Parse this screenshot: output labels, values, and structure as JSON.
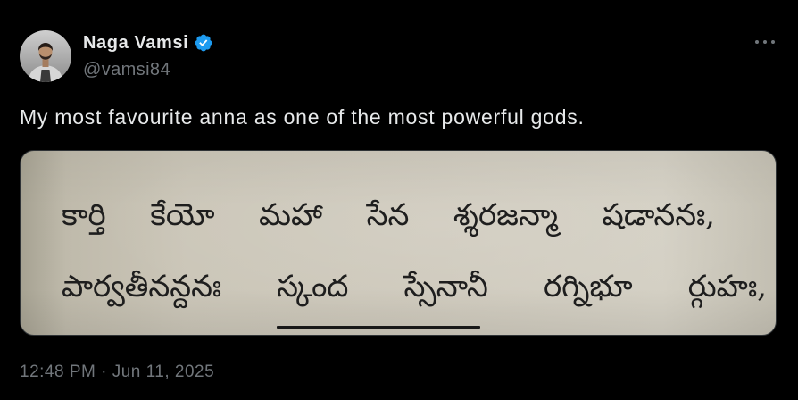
{
  "tweet": {
    "author": {
      "name": "Naga Vamsi",
      "handle": "@vamsi84",
      "verified": true,
      "avatar_icon": "avatar"
    },
    "text": "My most favourite anna as one of the most powerful gods.",
    "media": {
      "verse_lines": [
        [
          "కార్తి",
          "కేయో",
          "మహా",
          "సేన",
          "శ్శరజన్మా",
          "షడాననః,"
        ],
        [
          "పార్వతీనన్దనః",
          "స్కంద",
          "స్సేనానీ",
          "రగ్నిభూ",
          "ర్గుహః,"
        ]
      ],
      "underlined_word": "స్కంద"
    },
    "timestamp": "12:48 PM · Jun 11, 2025"
  },
  "icons": {
    "verified": "verified-badge-icon",
    "more": "more-icon"
  },
  "colors": {
    "background": "#000000",
    "primary_text": "#e7e9ea",
    "secondary_text": "#71767b",
    "verified": "#1d9bf0",
    "media_border": "#2f3336",
    "paper": "#cfcabd",
    "ink": "#1e1e1e"
  }
}
